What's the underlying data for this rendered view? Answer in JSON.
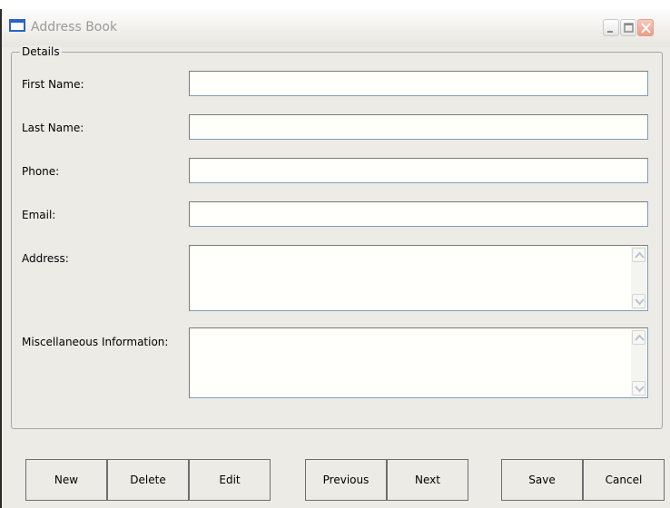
{
  "window": {
    "title": "Address Book",
    "controls": [
      "minimize-icon",
      "maximize-icon",
      "close-icon"
    ]
  },
  "details": {
    "group_label": "Details",
    "fields": {
      "first_name": {
        "label": "First Name:",
        "value": ""
      },
      "last_name": {
        "label": "Last Name:",
        "value": ""
      },
      "phone": {
        "label": "Phone:",
        "value": ""
      },
      "email": {
        "label": "Email:",
        "value": ""
      },
      "address": {
        "label": "Address:",
        "value": ""
      },
      "misc": {
        "label": "Miscellaneous Information:",
        "value": ""
      }
    }
  },
  "buttons": {
    "new": "New",
    "delete": "Delete",
    "edit": "Edit",
    "previous": "Previous",
    "next": "Next",
    "save": "Save",
    "cancel": "Cancel"
  },
  "colors": {
    "window_bg": "#ecebe6",
    "app_icon_blue": "#2a63c4",
    "close_button": "#ee9b86"
  }
}
